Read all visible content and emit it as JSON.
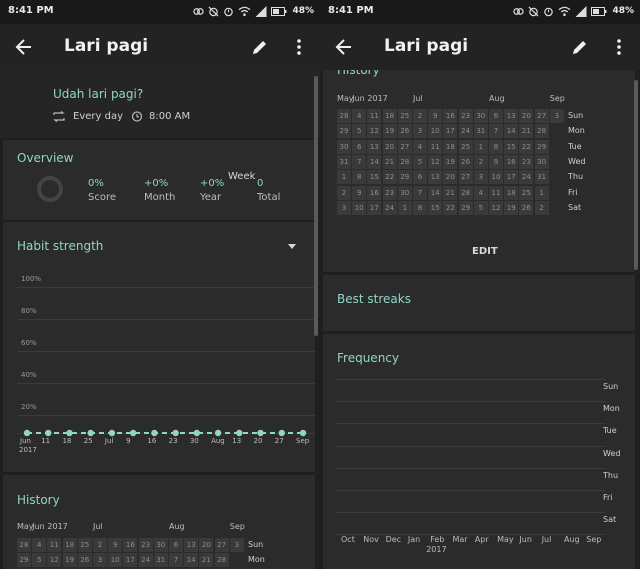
{
  "status": {
    "time": "8:41 PM",
    "battery": "48%"
  },
  "appbar": {
    "title": "Lari pagi"
  },
  "habit": {
    "question": "Udah lari pagi?",
    "frequency": "Every day",
    "reminder": "8:00 AM"
  },
  "overview": {
    "title": "Overview",
    "stats": [
      {
        "value": "0%",
        "label": "Score"
      },
      {
        "value": "+0%",
        "label": "Month"
      },
      {
        "value": "+0%",
        "label": "Year"
      },
      {
        "value": "0",
        "label": "Total"
      }
    ]
  },
  "strength": {
    "title": "Habit strength",
    "period": "Week",
    "ylabels": [
      "100%",
      "80%",
      "60%",
      "40%",
      "20%"
    ],
    "xlabels": [
      "Jun",
      "11",
      "18",
      "25",
      "Jul",
      "9",
      "16",
      "23",
      "30",
      "Aug",
      "13",
      "20",
      "27",
      "Sep"
    ],
    "year": "2017",
    "values": [
      0,
      0,
      0,
      0,
      0,
      0,
      0,
      0,
      0,
      0,
      0,
      0,
      0,
      0
    ]
  },
  "history": {
    "title": "History",
    "months": [
      {
        "label": "May",
        "col": 0
      },
      {
        "label": "Jun",
        "col": 1
      },
      {
        "label": "2017",
        "col": 2
      },
      {
        "label": "Jul",
        "col": 5
      },
      {
        "label": "Aug",
        "col": 10
      },
      {
        "label": "Sep",
        "col": 14
      }
    ],
    "days": [
      "Sun",
      "Mon",
      "Tue",
      "Wed",
      "Thu",
      "Fri",
      "Sat"
    ],
    "grid": [
      [
        "28",
        "4",
        "11",
        "18",
        "25",
        "2",
        "9",
        "16",
        "23",
        "30",
        "6",
        "13",
        "20",
        "27",
        "3"
      ],
      [
        "29",
        "5",
        "12",
        "19",
        "26",
        "3",
        "10",
        "17",
        "24",
        "31",
        "7",
        "14",
        "21",
        "28",
        ""
      ],
      [
        "30",
        "6",
        "13",
        "20",
        "27",
        "4",
        "11",
        "18",
        "25",
        "1",
        "8",
        "15",
        "22",
        "29",
        ""
      ],
      [
        "31",
        "7",
        "14",
        "21",
        "28",
        "5",
        "12",
        "19",
        "26",
        "2",
        "9",
        "16",
        "23",
        "30",
        ""
      ],
      [
        "1",
        "8",
        "15",
        "22",
        "29",
        "6",
        "13",
        "20",
        "27",
        "3",
        "10",
        "17",
        "24",
        "31",
        ""
      ],
      [
        "2",
        "9",
        "16",
        "23",
        "30",
        "7",
        "14",
        "21",
        "28",
        "4",
        "11",
        "18",
        "25",
        "1",
        ""
      ],
      [
        "3",
        "10",
        "17",
        "24",
        "1",
        "8",
        "15",
        "22",
        "29",
        "5",
        "12",
        "19",
        "26",
        "2",
        ""
      ]
    ],
    "edit_label": "EDIT"
  },
  "best_streaks": {
    "title": "Best streaks"
  },
  "frequency": {
    "title": "Frequency",
    "days": [
      "Sun",
      "Mon",
      "Tue",
      "Wed",
      "Thu",
      "Fri",
      "Sat"
    ],
    "months": [
      "Oct",
      "Nov",
      "Dec",
      "Jan",
      "Feb",
      "Mar",
      "Apr",
      "May",
      "Jun",
      "Jul",
      "Aug",
      "Sep"
    ],
    "year": "2017"
  },
  "colors": {
    "accent": "#8fd6c8",
    "card": "#2b2b2b"
  }
}
